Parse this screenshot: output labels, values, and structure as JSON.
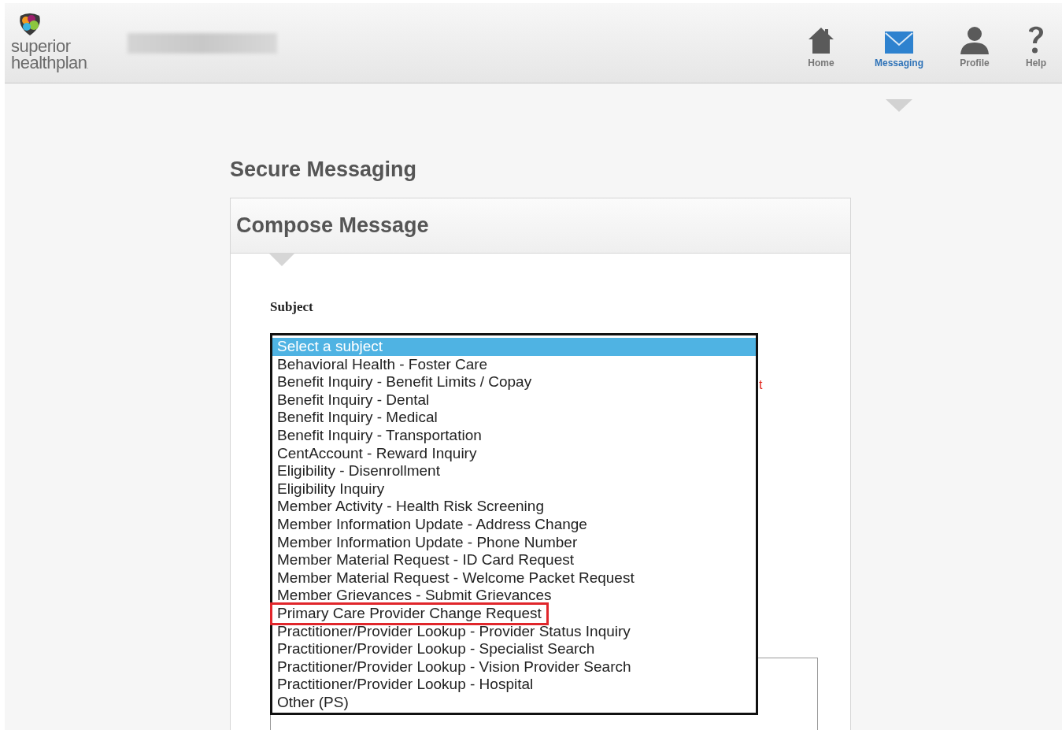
{
  "header": {
    "logo_text": [
      "superior",
      "healthplan"
    ],
    "logo_mark": ".",
    "nav": [
      {
        "label": "Home",
        "selected": false
      },
      {
        "label": "Messaging",
        "selected": true
      },
      {
        "label": "Profile",
        "selected": false
      },
      {
        "label": "Help",
        "selected": false
      }
    ]
  },
  "page_title": "Secure Messaging",
  "card": {
    "title": "Compose Message",
    "subject": {
      "label": "Subject",
      "hint_visible": "t",
      "options": [
        {
          "label": "Select a subject",
          "selected": true,
          "outlined": false
        },
        {
          "label": "Behavioral Health - Foster Care",
          "selected": false,
          "outlined": false
        },
        {
          "label": "Benefit Inquiry - Benefit Limits / Copay",
          "selected": false,
          "outlined": false
        },
        {
          "label": "Benefit Inquiry - Dental",
          "selected": false,
          "outlined": false
        },
        {
          "label": "Benefit Inquiry - Medical",
          "selected": false,
          "outlined": false
        },
        {
          "label": "Benefit Inquiry - Transportation",
          "selected": false,
          "outlined": false
        },
        {
          "label": "CentAccount - Reward Inquiry",
          "selected": false,
          "outlined": false
        },
        {
          "label": "Eligibility - Disenrollment",
          "selected": false,
          "outlined": false
        },
        {
          "label": "Eligibility Inquiry",
          "selected": false,
          "outlined": false
        },
        {
          "label": "Member Activity - Health Risk Screening",
          "selected": false,
          "outlined": false
        },
        {
          "label": "Member Information Update - Address Change",
          "selected": false,
          "outlined": false
        },
        {
          "label": "Member Information Update - Phone Number",
          "selected": false,
          "outlined": false
        },
        {
          "label": "Member Material Request - ID Card Request",
          "selected": false,
          "outlined": false
        },
        {
          "label": "Member Material Request - Welcome Packet Request",
          "selected": false,
          "outlined": false
        },
        {
          "label": "Member Grievances - Submit Grievances",
          "selected": false,
          "outlined": false
        },
        {
          "label": "Primary Care Provider Change Request",
          "selected": false,
          "outlined": true
        },
        {
          "label": "Practitioner/Provider Lookup - Provider Status Inquiry",
          "selected": false,
          "outlined": false
        },
        {
          "label": "Practitioner/Provider Lookup - Specialist Search",
          "selected": false,
          "outlined": false
        },
        {
          "label": "Practitioner/Provider Lookup - Vision Provider Search",
          "selected": false,
          "outlined": false
        },
        {
          "label": "Practitioner/Provider Lookup - Hospital",
          "selected": false,
          "outlined": false
        },
        {
          "label": "Other (PS)",
          "selected": false,
          "outlined": false
        }
      ]
    }
  }
}
